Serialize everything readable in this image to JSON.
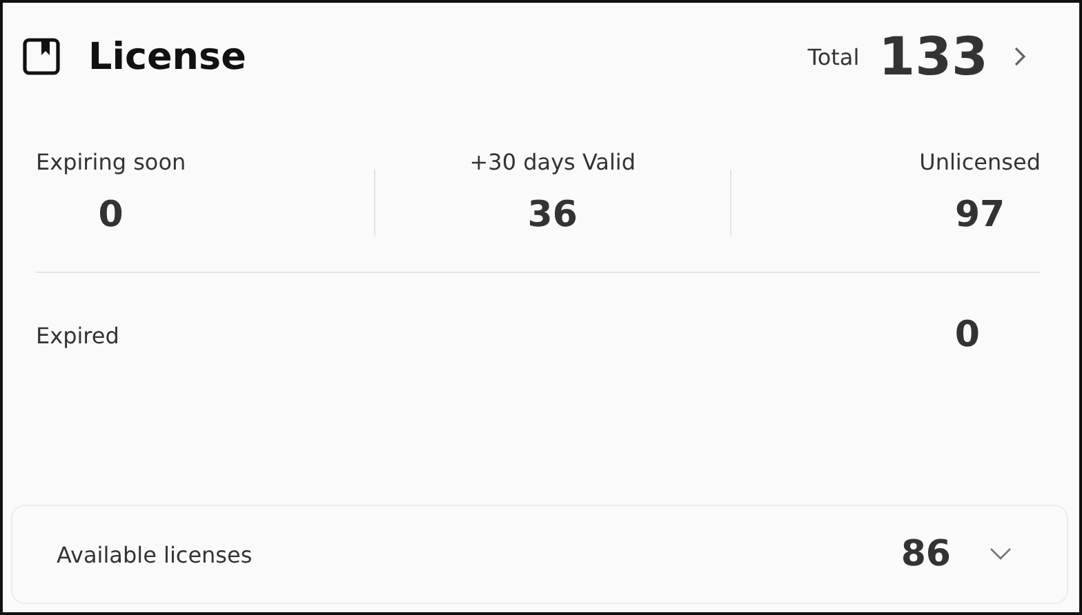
{
  "card": {
    "title": "License",
    "total_label": "Total",
    "total_value": "133"
  },
  "stats": [
    {
      "label": "Expiring soon",
      "value": "0"
    },
    {
      "label": "+30 days Valid",
      "value": "36"
    },
    {
      "label": "Unlicensed",
      "value": "97"
    }
  ],
  "expired": {
    "label": "Expired",
    "value": "0"
  },
  "available": {
    "label": "Available licenses",
    "value": "86",
    "expanded": false
  }
}
